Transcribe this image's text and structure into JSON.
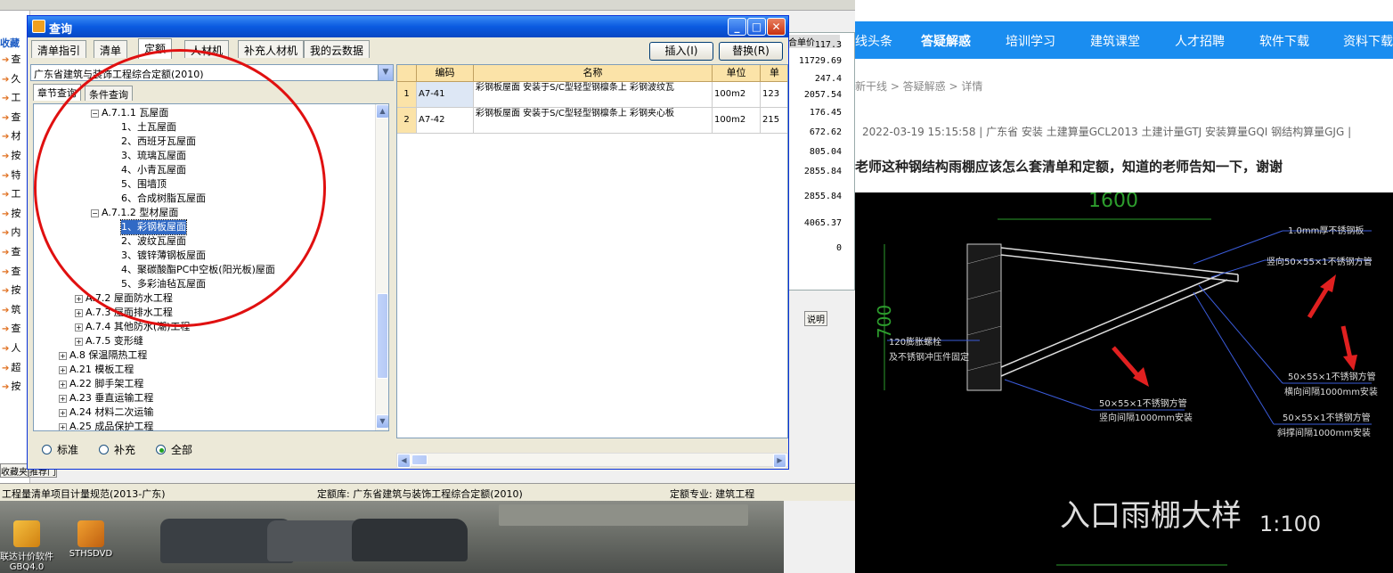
{
  "dialog": {
    "title": "查询",
    "tabs": [
      "清单指引",
      "清单",
      "定额",
      "人材机",
      "补充人材机",
      "我的云数据"
    ],
    "active_tab": "定额",
    "insert_label": "插入(I)",
    "replace_label": "替换(R)",
    "library_select": "广东省建筑与装饰工程综合定额(2010)",
    "subtabs": [
      "章节查询",
      "条件查询"
    ],
    "tree": [
      {
        "label": "A.7.1.1 瓦屋面",
        "expander": "⊟"
      },
      {
        "label": "1、土瓦屋面"
      },
      {
        "label": "2、西班牙瓦屋面"
      },
      {
        "label": "3、琉璃瓦屋面"
      },
      {
        "label": "4、小青瓦屋面"
      },
      {
        "label": "5、围墙顶"
      },
      {
        "label": "6、合成树脂瓦屋面"
      },
      {
        "label": "A.7.1.2 型材屋面",
        "expander": "⊟"
      },
      {
        "label": "1、彩钢板屋面",
        "selected": true
      },
      {
        "label": "2、波纹瓦屋面"
      },
      {
        "label": "3、镀锌薄钢板屋面"
      },
      {
        "label": "4、聚碳酸酯PC中空板(阳光板)屋面"
      },
      {
        "label": "5、多彩油毡瓦屋面"
      },
      {
        "label": "A.7.2 屋面防水工程",
        "expander": "⊞"
      },
      {
        "label": "A.7.3 屋面排水工程",
        "expander": "⊞"
      },
      {
        "label": "A.7.4 其他防水(潮)工程",
        "expander": "⊞"
      },
      {
        "label": "A.7.5 变形缝",
        "expander": "⊞"
      },
      {
        "label": "A.8 保温隔热工程",
        "expander": "⊞"
      },
      {
        "label": "A.21 模板工程",
        "expander": "⊞"
      },
      {
        "label": "A.22 脚手架工程",
        "expander": "⊞"
      },
      {
        "label": "A.23 垂直运输工程",
        "expander": "⊞"
      },
      {
        "label": "A.24 材料二次运输",
        "expander": "⊞"
      },
      {
        "label": "A.25 成品保护工程",
        "expander": "⊞"
      }
    ],
    "radios": [
      {
        "label": "标准",
        "checked": false
      },
      {
        "label": "补充",
        "checked": false
      },
      {
        "label": "全部",
        "checked": true
      }
    ],
    "grid": {
      "headers": [
        "编码",
        "名称",
        "单位",
        "单"
      ],
      "rows": [
        {
          "no": "1",
          "code": "A7-41",
          "name": "彩钢板屋面 安装于S/C型轻型钢檩条上 彩钢波纹瓦",
          "unit": "100m2",
          "price": "123"
        },
        {
          "no": "2",
          "code": "A7-42",
          "name": "彩钢板屋面 安装于S/C型轻型钢檩条上 彩钢夹心板",
          "unit": "100m2",
          "price": "215"
        }
      ]
    }
  },
  "background_app": {
    "left_items": [
      "收藏",
      "查",
      "久",
      "工",
      "查",
      "材",
      "按",
      "特",
      "工",
      "按",
      "内",
      "查",
      "查",
      "按",
      "筑",
      "查",
      "人",
      "超",
      "按"
    ],
    "bottom_tabs": [
      "收藏夹",
      "推荐门"
    ],
    "price_header": "合单价",
    "prices": [
      "117.3",
      "11729.69",
      "247.4",
      "2057.54",
      "176.45",
      "672.62",
      "805.04",
      "2855.84",
      "2855.84",
      "4065.37",
      "0"
    ],
    "side_label": "说明",
    "status": {
      "bill_spec": "工程量清单项目计量规范(2013-广东)",
      "quota_lib": "定额库: 广东省建筑与装饰工程综合定额(2010)",
      "quota_major": "定额专业: 建筑工程"
    }
  },
  "desktop_icons": [
    "联达计价软件GBQ4.0",
    "STHSDVD"
  ],
  "website": {
    "nav": [
      "线头条",
      "答疑解惑",
      "培训学习",
      "建筑课堂",
      "人才招聘",
      "软件下载",
      "资料下载"
    ],
    "breadcrumb": "新干线 > 答疑解惑 > 详情",
    "meta": "2022-03-19 15:15:58    |    广东省  安装 土建算量GCL2013 土建计量GTJ 安装算量GQI 钢结构算量GJG    |",
    "question": "老师这种钢结构雨棚应该怎么套清单和定额，知道的老师告知一下，谢谢",
    "drawing": {
      "dim_top": "1600",
      "dim_left": "700",
      "label1": "1.0mm厚不锈钢板",
      "label2": "竖向50×55×1不锈钢方管",
      "label3": "120膨胀螺栓",
      "label4": "及不锈钢冲压件固定",
      "label5": "50×55×1不锈钢方管",
      "label6": "竖向间隔1000mm安装",
      "label7": "50×55×1不锈钢方管",
      "label8": "横向间隔1000mm安装",
      "label9": "50×55×1不锈钢方管",
      "label10": "斜撑间隔1000mm安装",
      "title": "入口雨棚大样",
      "scale": "1:100"
    }
  }
}
